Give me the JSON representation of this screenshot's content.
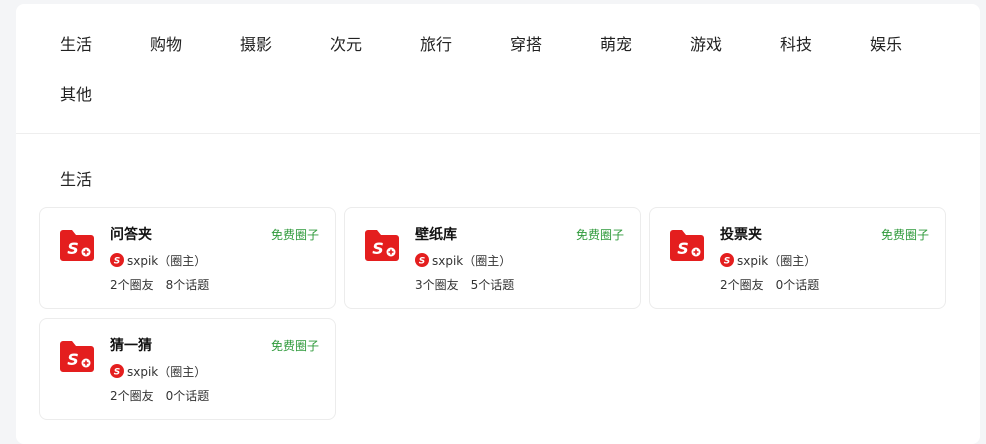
{
  "categories": [
    "生活",
    "购物",
    "摄影",
    "次元",
    "旅行",
    "穿搭",
    "萌宠",
    "游戏",
    "科技",
    "娱乐",
    "其他"
  ],
  "section": {
    "title": "生活"
  },
  "brand": {
    "accent": "#e41e1e",
    "badge_color": "#2f9a3b",
    "logo_glyph": "S+"
  },
  "cards": [
    {
      "name": "问答夹",
      "badge": "免费圈子",
      "owner": "sxpik",
      "owner_role": "（圈主）",
      "members": "2个圈友",
      "topics": "8个话题"
    },
    {
      "name": "壁纸库",
      "badge": "免费圈子",
      "owner": "sxpik",
      "owner_role": "（圈主）",
      "members": "3个圈友",
      "topics": "5个话题"
    },
    {
      "name": "投票夹",
      "badge": "免费圈子",
      "owner": "sxpik",
      "owner_role": "（圈主）",
      "members": "2个圈友",
      "topics": "0个话题"
    },
    {
      "name": "猜一猜",
      "badge": "免费圈子",
      "owner": "sxpik",
      "owner_role": "（圈主）",
      "members": "2个圈友",
      "topics": "0个话题"
    }
  ]
}
